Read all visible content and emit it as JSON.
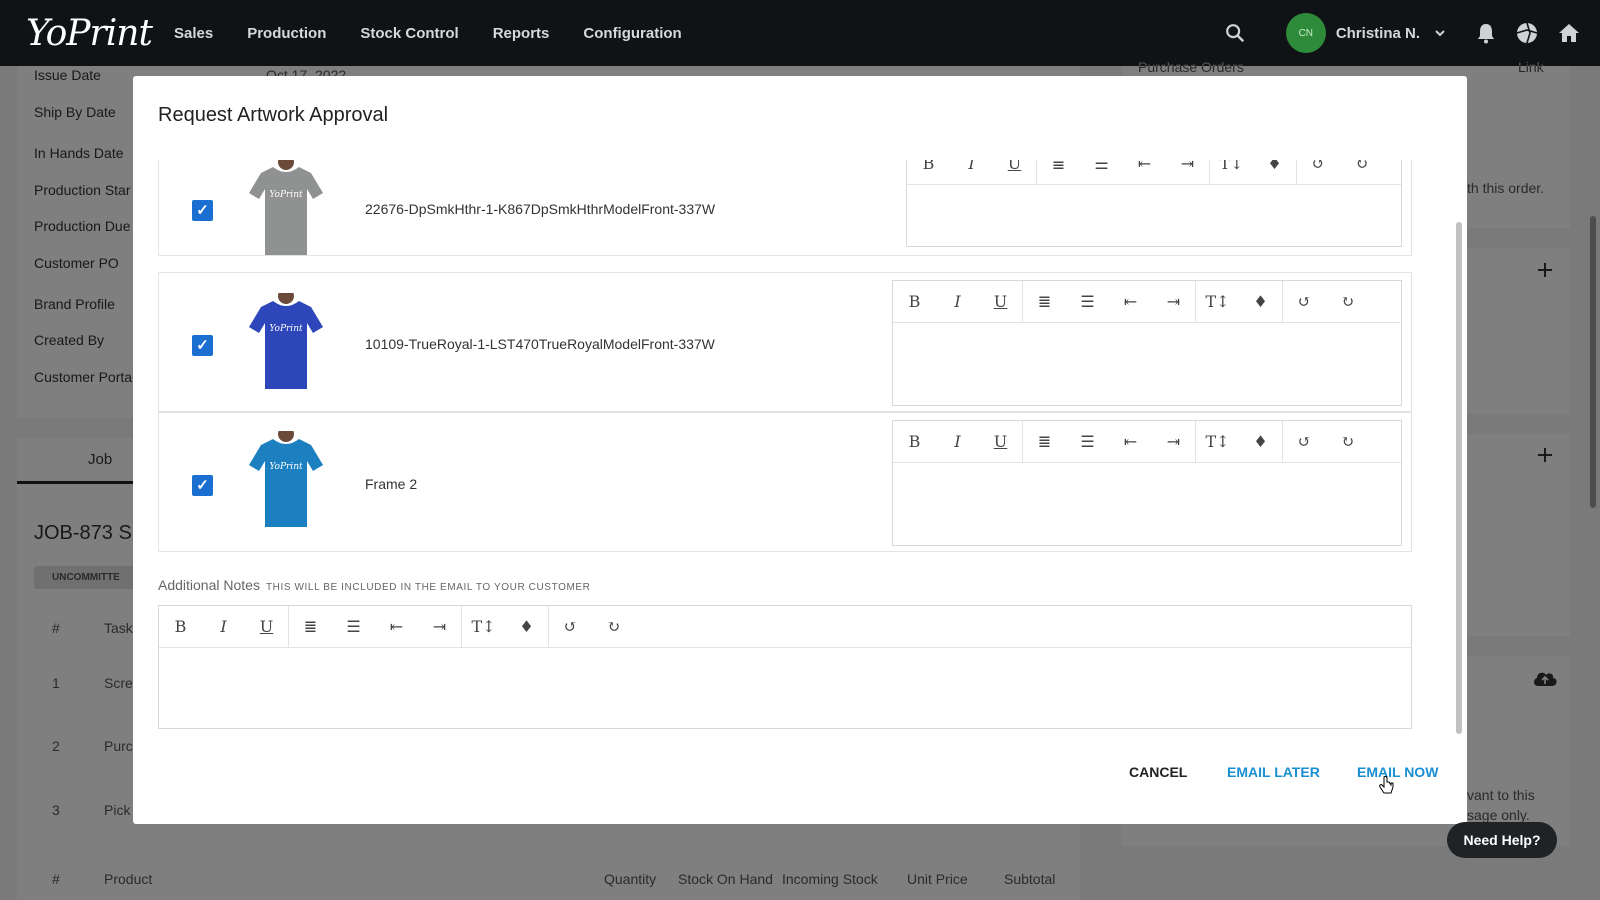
{
  "brand": "YoPrint",
  "nav": [
    "Sales",
    "Production",
    "Stock Control",
    "Reports",
    "Configuration"
  ],
  "user": {
    "initials": "CN",
    "name": "Christina N."
  },
  "background": {
    "labels": [
      "Issue Date",
      "Ship By Date",
      "In Hands Date",
      "Production Star",
      "Production Due",
      "Customer PO",
      "Brand Profile",
      "Created By",
      "Customer Porta"
    ],
    "issue_date_value": "Oct 17, 2022",
    "purchase_orders": "Purchase Orders",
    "link": "Link",
    "with_order": "th this order.",
    "tab_job": "Job",
    "job_title": "JOB-873 S",
    "badge": "UNCOMMITTE",
    "task_header_num": "#",
    "task_header_task": "Task",
    "tasks": [
      {
        "num": "1",
        "name": "Scre"
      },
      {
        "num": "2",
        "name": "Purc"
      },
      {
        "num": "3",
        "name": "Pick"
      }
    ],
    "product_headers": [
      "#",
      "Product",
      "Quantity",
      "Stock On Hand",
      "Incoming Stock",
      "Unit Price",
      "Subtotal"
    ],
    "relevant_text": "vant to this",
    "usage_text": "sage only."
  },
  "modal": {
    "title": "Request Artwork Approval",
    "items": [
      {
        "name": "22676-DpSmkHthr-1-K867DpSmkHthrModelFront-337W",
        "shirt_color": "#8f9290",
        "checked": true
      },
      {
        "name": "10109-TrueRoyal-1-LST470TrueRoyalModelFront-337W",
        "shirt_color": "#2d46b9",
        "checked": true
      },
      {
        "name": "Frame 2",
        "shirt_color": "#1c7fc0",
        "checked": true
      }
    ],
    "toolbar_glyphs": [
      "B",
      "I",
      "U",
      "≣",
      "☰",
      "⇤",
      "⇥",
      "T↕",
      "♦",
      "↺",
      "↻"
    ],
    "notes_label": "Additional Notes",
    "notes_sub": "THIS WILL BE INCLUDED IN THE EMAIL TO YOUR CUSTOMER",
    "cancel": "CANCEL",
    "email_later": "EMAIL LATER",
    "email_now": "EMAIL NOW",
    "shirt_print": "YoPrint"
  },
  "help": "Need Help?"
}
